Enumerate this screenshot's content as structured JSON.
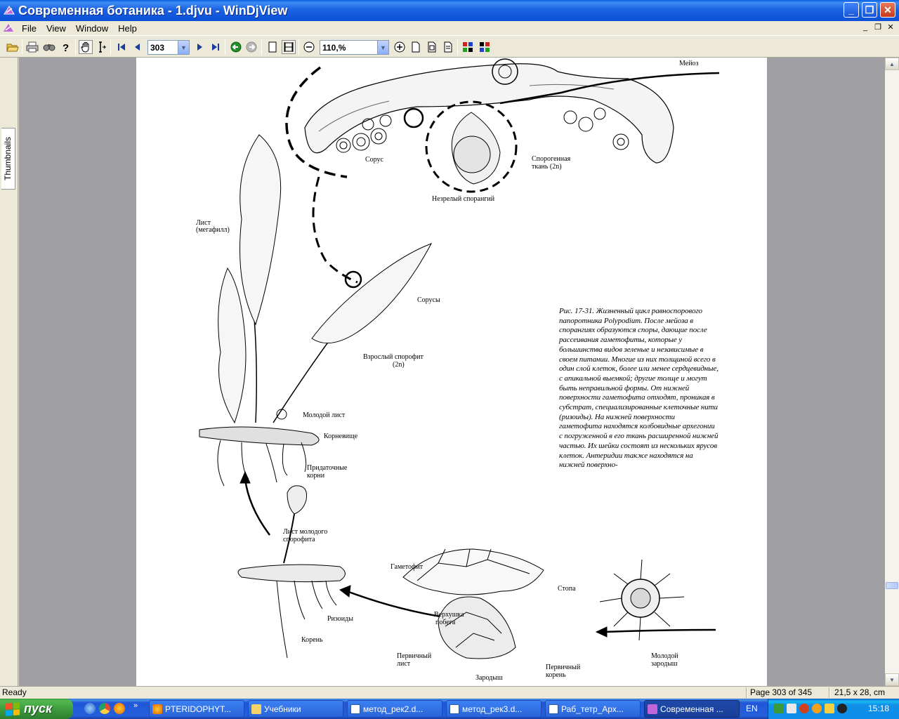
{
  "window": {
    "title": "Современная ботаника - 1.djvu - WinDjView",
    "controls": {
      "minimize": "_",
      "maximize": "❐",
      "close": "✕"
    }
  },
  "menubar": {
    "items": [
      "File",
      "View",
      "Window",
      "Help"
    ]
  },
  "toolbar": {
    "page_number": "303",
    "zoom": "110,%"
  },
  "sidebar": {
    "tab_label": "Thumbnails"
  },
  "document": {
    "caption": "Рис. 17-31. Жизненный цикл равноспорового папоротника Polypodium. После мейоза в спорангиях образуются споры, дающие после рассеивания гаметофиты, которые у большинства видов зеленые и независимые в своем питании. Многие из них толщиной всего в один слой клеток, более или менее сердцевидные, с апикальной выемкой; другие толще и могут быть неправильной формы. От нижней поверхности гаметофита отходят, проникая в субстрат, специализированные клеточные нити (ризоиды). На нижней поверхности гаметофита находятся колбовидные архегонии с погруженной в его ткань расширенной нижней частью. Их шейки состоят из нескольких ярусов клеток. Антеридии также находятся на нижней поверхно-",
    "labels": {
      "meiosis": "Мейоз",
      "sorus": "Сорус",
      "sporogenous_1": "Спорогенная",
      "sporogenous_2": "ткань (2n)",
      "immature_sporangium": "Незрелый спорангий",
      "leaf_1": "Лист",
      "leaf_2": "(мегафилл)",
      "sori": "Сорусы",
      "sporophyte_1": "Взрослый спорофит",
      "sporophyte_2": "(2n)",
      "young_leaf": "Молодой лист",
      "rhizome": "Корневище",
      "adv_roots_1": "Придаточные",
      "adv_roots_2": "корни",
      "young_sporophyte_leaf_1": "Лист молодого",
      "young_sporophyte_leaf_2": "спорофита",
      "gametophyte": "Гаметофит",
      "foot": "Стопа",
      "shoot_apex_1": "Верхушка",
      "shoot_apex_2": "побега",
      "rhizoids": "Ризоиды",
      "root": "Корень",
      "primary_leaf_1": "Первичный",
      "primary_leaf_2": "лист",
      "embryo": "Зародыш",
      "primary_root_1": "Первичный",
      "primary_root_2": "корень",
      "young_embryo_1": "Молодой",
      "young_embryo_2": "зародыш"
    }
  },
  "status": {
    "ready": "Ready",
    "page": "Page 303 of 345",
    "size": "21,5 x 28, cm"
  },
  "taskbar": {
    "start": "пуск",
    "tasks": [
      "PTERIDOPHYT...",
      "Учебники",
      "метод_рек2.d...",
      "метод_рек3.d...",
      "Раб_тетр_Арх...",
      "Современная ..."
    ],
    "lang": "EN",
    "clock": "15:18"
  },
  "colors": {
    "titlebar": "#0b4fd6",
    "taskbar": "#245edb",
    "start": "#3a963a",
    "chrome": "#ece9d8"
  }
}
